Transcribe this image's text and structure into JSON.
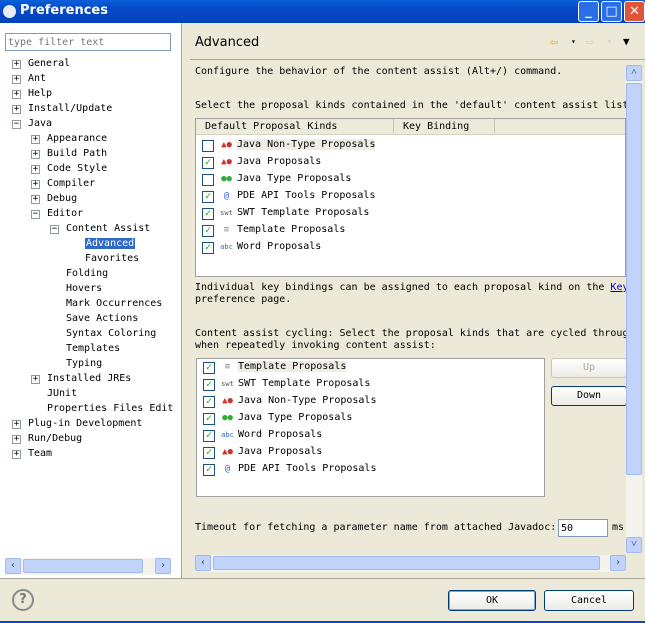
{
  "window": {
    "title": "Preferences"
  },
  "filter": {
    "placeholder": "type filter text"
  },
  "tree": [
    {
      "label": "General",
      "level": 0,
      "exp": "+"
    },
    {
      "label": "Ant",
      "level": 0,
      "exp": "+"
    },
    {
      "label": "Help",
      "level": 0,
      "exp": "+"
    },
    {
      "label": "Install/Update",
      "level": 0,
      "exp": "+"
    },
    {
      "label": "Java",
      "level": 0,
      "exp": "-"
    },
    {
      "label": "Appearance",
      "level": 1,
      "exp": "+"
    },
    {
      "label": "Build Path",
      "level": 1,
      "exp": "+"
    },
    {
      "label": "Code Style",
      "level": 1,
      "exp": "+"
    },
    {
      "label": "Compiler",
      "level": 1,
      "exp": "+"
    },
    {
      "label": "Debug",
      "level": 1,
      "exp": "+"
    },
    {
      "label": "Editor",
      "level": 1,
      "exp": "-"
    },
    {
      "label": "Content Assist",
      "level": 2,
      "exp": "-"
    },
    {
      "label": "Advanced",
      "level": 3,
      "selected": true
    },
    {
      "label": "Favorites",
      "level": 3
    },
    {
      "label": "Folding",
      "level": 2
    },
    {
      "label": "Hovers",
      "level": 2
    },
    {
      "label": "Mark Occurrences",
      "level": 2
    },
    {
      "label": "Save Actions",
      "level": 2
    },
    {
      "label": "Syntax Coloring",
      "level": 2
    },
    {
      "label": "Templates",
      "level": 2
    },
    {
      "label": "Typing",
      "level": 2
    },
    {
      "label": "Installed JREs",
      "level": 1,
      "exp": "+"
    },
    {
      "label": "JUnit",
      "level": 1
    },
    {
      "label": "Properties Files Edit",
      "level": 1
    },
    {
      "label": "Plug-in Development",
      "level": 0,
      "exp": "+"
    },
    {
      "label": "Run/Debug",
      "level": 0,
      "exp": "+"
    },
    {
      "label": "Team",
      "level": 0,
      "exp": "+"
    }
  ],
  "page": {
    "title": "Advanced",
    "intro": "Configure the behavior of the content assist (Alt+/) command.",
    "select_label": "Select the proposal kinds contained in the 'default' content assist list",
    "columns": [
      "Default Proposal Kinds",
      "Key Binding"
    ],
    "default_kinds": [
      {
        "label": "Java Non-Type Proposals",
        "checked": false,
        "icon": "java-icon"
      },
      {
        "label": "Java Proposals",
        "checked": true,
        "icon": "java-icon"
      },
      {
        "label": "Java Type Proposals",
        "checked": false,
        "icon": "type-icon"
      },
      {
        "label": "PDE API Tools Proposals",
        "checked": true,
        "icon": "at-icon"
      },
      {
        "label": "SWT Template Proposals",
        "checked": true,
        "icon": "swt-icon"
      },
      {
        "label": "Template Proposals",
        "checked": true,
        "icon": "template-icon"
      },
      {
        "label": "Word Proposals",
        "checked": true,
        "icon": "word-icon"
      }
    ],
    "keys_note_1": "Individual key bindings can be assigned to each proposal kind on the ",
    "keys_link": "Keys",
    "keys_note_2": "preference page.",
    "cycling_label_1": "Content assist cycling: Select the proposal kinds that are cycled through",
    "cycling_label_2": "when repeatedly invoking content assist:",
    "cycling_kinds": [
      {
        "label": "Template Proposals",
        "checked": true,
        "icon": "template-icon"
      },
      {
        "label": "SWT Template Proposals",
        "checked": true,
        "icon": "swt-icon"
      },
      {
        "label": "Java Non-Type Proposals",
        "checked": true,
        "icon": "java-icon"
      },
      {
        "label": "Java Type Proposals",
        "checked": true,
        "icon": "type-icon"
      },
      {
        "label": "Word Proposals",
        "checked": true,
        "icon": "word-icon"
      },
      {
        "label": "Java Proposals",
        "checked": true,
        "icon": "java-icon"
      },
      {
        "label": "PDE API Tools Proposals",
        "checked": true,
        "icon": "at-icon"
      }
    ],
    "up": "Up",
    "down": "Down",
    "timeout_label": "Timeout for fetching a parameter name from attached Javadoc:",
    "timeout_value": "50",
    "timeout_unit": "ms"
  },
  "footer": {
    "ok": "OK",
    "cancel": "Cancel"
  }
}
